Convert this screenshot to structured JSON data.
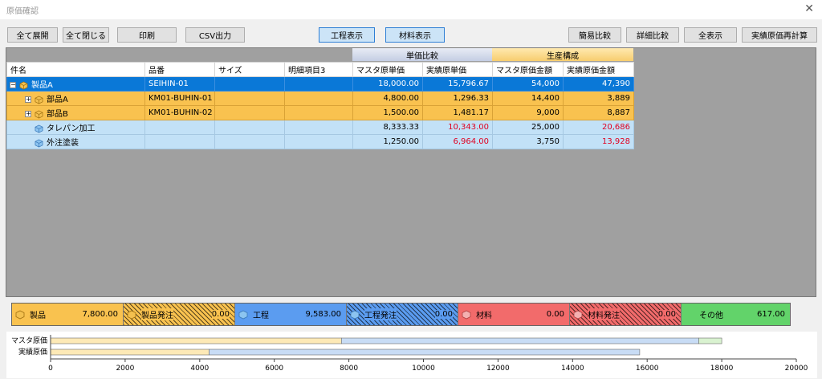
{
  "window": {
    "title": "原価確認",
    "close_glyph": "✕"
  },
  "toolbar": {
    "expand_all": "全て展開",
    "collapse_all": "全て閉じる",
    "print": "印刷",
    "csv": "CSV出力",
    "process_view": "工程表示",
    "material_view": "材料表示",
    "simple_compare": "簡易比較",
    "detail_compare": "詳細比較",
    "show_all": "全表示",
    "recalc": "実績原価再計算"
  },
  "grid": {
    "group_unit": "単価比較",
    "group_prod": "生産構成",
    "columns": [
      "件名",
      "品番",
      "サイズ",
      "明細項目3",
      "マスタ原単価",
      "実績原単価",
      "マスタ原価金額",
      "実績原価金額"
    ],
    "rows": [
      {
        "name": "製品A",
        "code": "SEIHIN-01",
        "size": "",
        "item3": "",
        "m_unit": "18,000.00",
        "a_unit": "15,796.67",
        "m_amt": "54,000",
        "a_amt": "47,390"
      },
      {
        "name": "部品A",
        "code": "KM01-BUHIN-01",
        "size": "",
        "item3": "",
        "m_unit": "4,800.00",
        "a_unit": "1,296.33",
        "m_amt": "14,400",
        "a_amt": "3,889"
      },
      {
        "name": "部品B",
        "code": "KM01-BUHIN-02",
        "size": "",
        "item3": "",
        "m_unit": "1,500.00",
        "a_unit": "1,481.17",
        "m_amt": "9,000",
        "a_amt": "8,887"
      },
      {
        "name": "タレパン加工",
        "code": "",
        "size": "",
        "item3": "",
        "m_unit": "8,333.33",
        "a_unit": "10,343.00",
        "m_amt": "25,000",
        "a_amt": "20,686"
      },
      {
        "name": "外注塗装",
        "code": "",
        "size": "",
        "item3": "",
        "m_unit": "1,250.00",
        "a_unit": "6,964.00",
        "m_amt": "3,750",
        "a_amt": "13,928"
      }
    ]
  },
  "summary": [
    {
      "label": "製品",
      "value": "7,800.00",
      "color": "#f9c24f",
      "hatch": false
    },
    {
      "label": "製品発注",
      "value": "0.00",
      "color": "#f9c24f",
      "hatch": true
    },
    {
      "label": "工程",
      "value": "9,583.00",
      "color": "#5b9cf0",
      "hatch": false
    },
    {
      "label": "工程発注",
      "value": "0.00",
      "color": "#5b9cf0",
      "hatch": true
    },
    {
      "label": "材料",
      "value": "0.00",
      "color": "#f26b6b",
      "hatch": false
    },
    {
      "label": "材料発注",
      "value": "0.00",
      "color": "#f26b6b",
      "hatch": true
    },
    {
      "label": "その他",
      "value": "617.00",
      "color": "#62d36a",
      "hatch": false
    }
  ],
  "chart_data": {
    "type": "bar",
    "orientation": "horizontal",
    "stacked": true,
    "categories": [
      "マスタ原価",
      "実績原価"
    ],
    "series": [
      {
        "name": "製品",
        "color": "#fde9b6",
        "values": [
          7800,
          4250
        ]
      },
      {
        "name": "工程",
        "color": "#c8dcf5",
        "values": [
          9583,
          11550
        ]
      },
      {
        "name": "その他",
        "color": "#d9f2d0",
        "values": [
          617,
          0
        ]
      }
    ],
    "xlim": [
      0,
      20000
    ],
    "xticks": [
      0,
      2000,
      4000,
      6000,
      8000,
      10000,
      12000,
      14000,
      16000,
      18000,
      20000
    ]
  }
}
